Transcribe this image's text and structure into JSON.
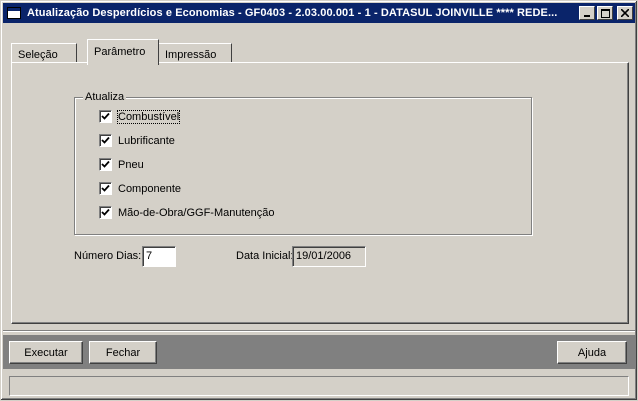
{
  "window": {
    "title": "Atualização Desperdícios e Economias - GF0403 - 2.03.00.001 - 1 - DATASUL JOINVILLE **** REDE...",
    "min_label": "_",
    "max_label": "□",
    "close_label": "×"
  },
  "tabs": [
    {
      "label": "Seleção"
    },
    {
      "label": "Parâmetro"
    },
    {
      "label": "Impressão"
    }
  ],
  "group": {
    "title": "Atualiza",
    "items": [
      {
        "label": "Combustível",
        "checked": true
      },
      {
        "label": "Lubrificante",
        "checked": true
      },
      {
        "label": "Pneu",
        "checked": true
      },
      {
        "label": "Componente",
        "checked": true
      },
      {
        "label": "Mão-de-Obra/GGF-Manutenção",
        "checked": true
      }
    ]
  },
  "fields": {
    "numero_dias_label": "Número Dias:",
    "numero_dias_value": "7",
    "data_inicial_label": "Data Inicial:",
    "data_inicial_value": "19/01/2006"
  },
  "buttons": {
    "executar": "Executar",
    "fechar": "Fechar",
    "ajuda": "Ajuda"
  },
  "status": {
    "text": ""
  }
}
